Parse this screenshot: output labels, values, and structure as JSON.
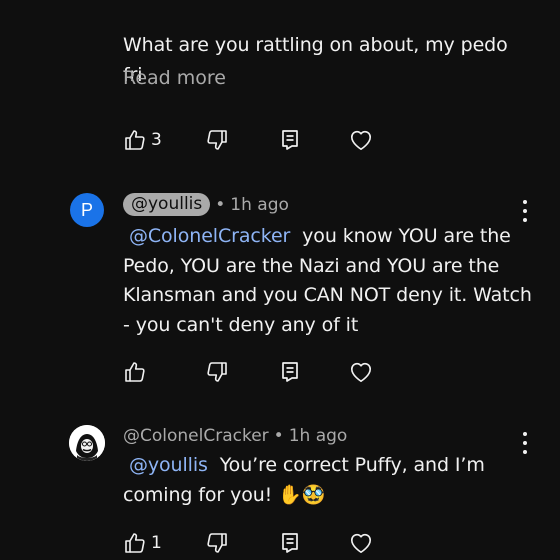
{
  "comment1": {
    "text": "What are you rattling on about, my pedo fri",
    "read_more": "Read more",
    "like_count": "3"
  },
  "comment2": {
    "avatar_letter": "P",
    "author": "@youllis",
    "separator": "•",
    "time": "1h ago",
    "mention": "@ColonelCracker",
    "line1_rest": "you know YOU are the",
    "line2": "Pedo, YOU are the Nazi and YOU are the",
    "line3": "Klansman and you CAN NOT deny it. Watch",
    "line4": "- you can't deny any of it",
    "like_count": ""
  },
  "comment3": {
    "author": "@ColonelCracker",
    "separator": "•",
    "time": "1h ago",
    "mention": "@youllis",
    "line1_rest": "You’re correct Puffy, and I’m",
    "line2": "coming for you! ✋🥸",
    "like_count": "1"
  },
  "icons": {
    "like": "thumbs-up-icon",
    "dislike": "thumbs-down-icon",
    "reply": "reply-comment-icon",
    "heart": "heart-icon",
    "more": "more-vertical-icon",
    "avatar": "avatar-image"
  },
  "colors": {
    "background": "#0f0f0f",
    "text": "#f1f1f1",
    "secondary": "#aaaaaa",
    "mention": "#8eb4f5",
    "avatar_blue": "#1a73e8"
  }
}
